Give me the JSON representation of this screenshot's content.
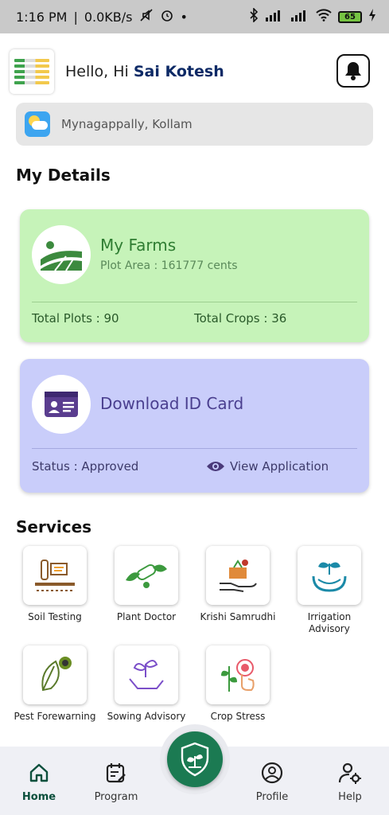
{
  "status_bar": {
    "time": "1:16 PM",
    "speed": "0.0KB/s",
    "battery": "65"
  },
  "header": {
    "greeting": "Hello, Hi",
    "user_name": "Sai Kotesh"
  },
  "location": {
    "text": "Mynagappally, Kollam"
  },
  "my_details": {
    "title": "My Details",
    "farms": {
      "title": "My Farms",
      "plot_area": "Plot Area : 161777 cents",
      "total_plots": "Total Plots : 90",
      "total_crops": "Total Crops : 36"
    },
    "id_card": {
      "title": "Download ID Card",
      "status": "Status : Approved",
      "view_application": "View Application"
    }
  },
  "services": {
    "title": "Services",
    "items": [
      {
        "label": "Soil Testing",
        "icon": "soil-testing-icon"
      },
      {
        "label": "Plant Doctor",
        "icon": "plant-doctor-icon"
      },
      {
        "label": "Krishi Samrudhi",
        "icon": "krishi-samrudhi-icon"
      },
      {
        "label": "Irrigation Advisory",
        "icon": "irrigation-icon"
      },
      {
        "label": "Pest Forewarning",
        "icon": "pest-icon"
      },
      {
        "label": "Sowing Advisory",
        "icon": "sowing-icon"
      },
      {
        "label": "Crop Stress",
        "icon": "crop-stress-icon"
      }
    ]
  },
  "bottom_nav": {
    "home": "Home",
    "program": "Program",
    "profile": "Profile",
    "help": "Help"
  },
  "colors": {
    "farms_card": "#c6f3b9",
    "id_card": "#c9cdfa",
    "accent_green": "#1b7a52",
    "name_blue": "#0d2a66"
  }
}
